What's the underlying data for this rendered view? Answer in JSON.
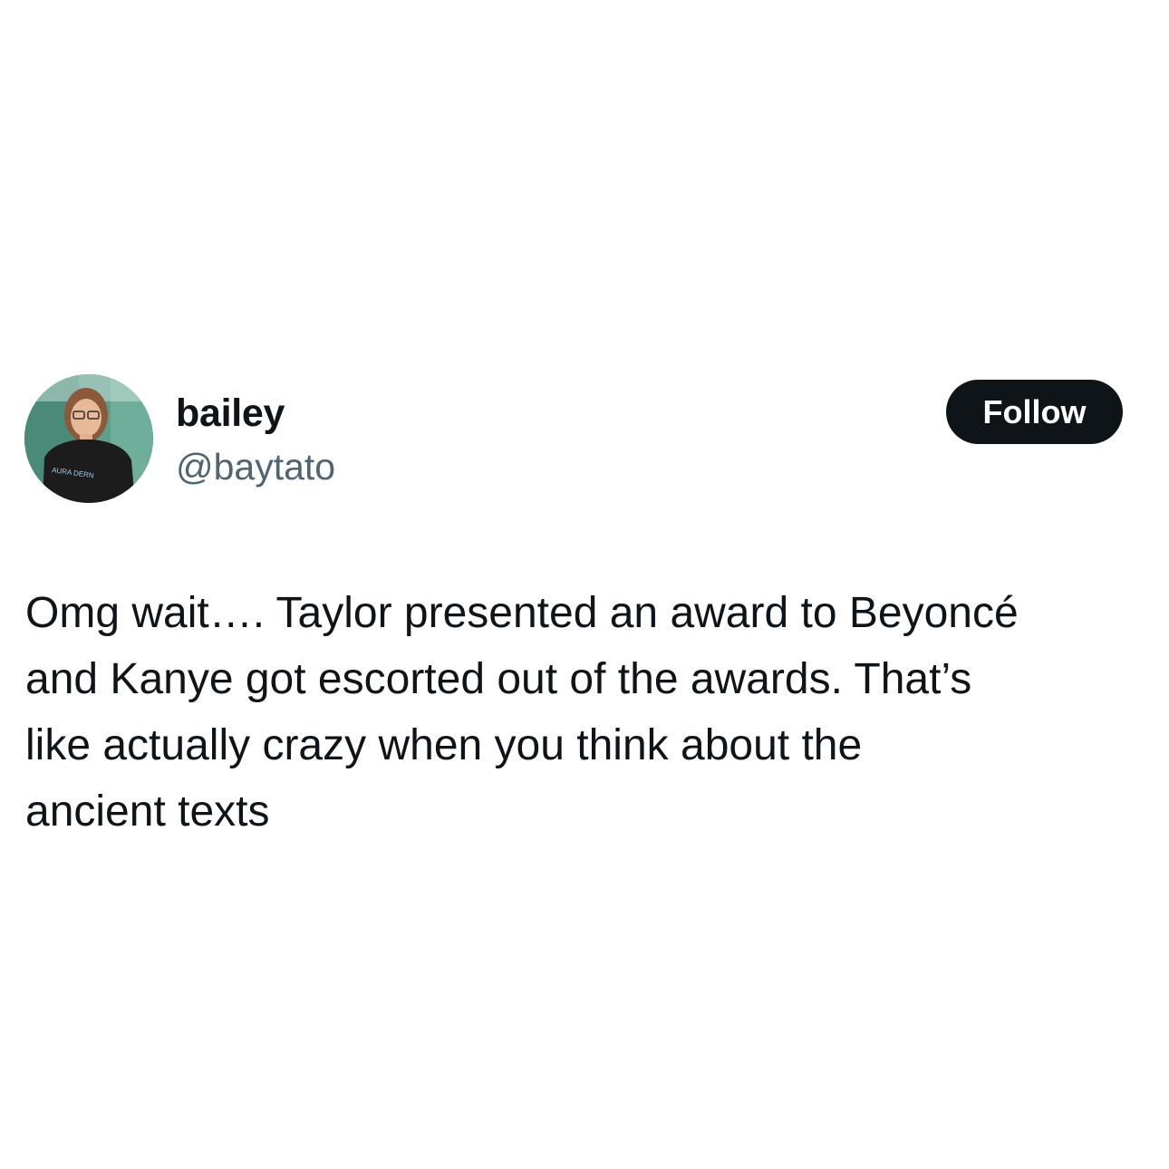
{
  "author": {
    "display_name": "bailey",
    "handle": "@baytato",
    "avatar_shirt_text": "AURA DERN"
  },
  "actions": {
    "follow_label": "Follow"
  },
  "tweet": {
    "lines": [
      "Omg wait…. Taylor presented an award to Beyoncé",
      "and Kanye got escorted out of the awards. That’s",
      "like actually crazy when you think about the",
      "ancient texts"
    ]
  },
  "colors": {
    "text_primary": "#0f1419",
    "text_secondary": "#536471",
    "button_bg": "#0f1419",
    "button_text": "#ffffff",
    "background": "#ffffff"
  }
}
